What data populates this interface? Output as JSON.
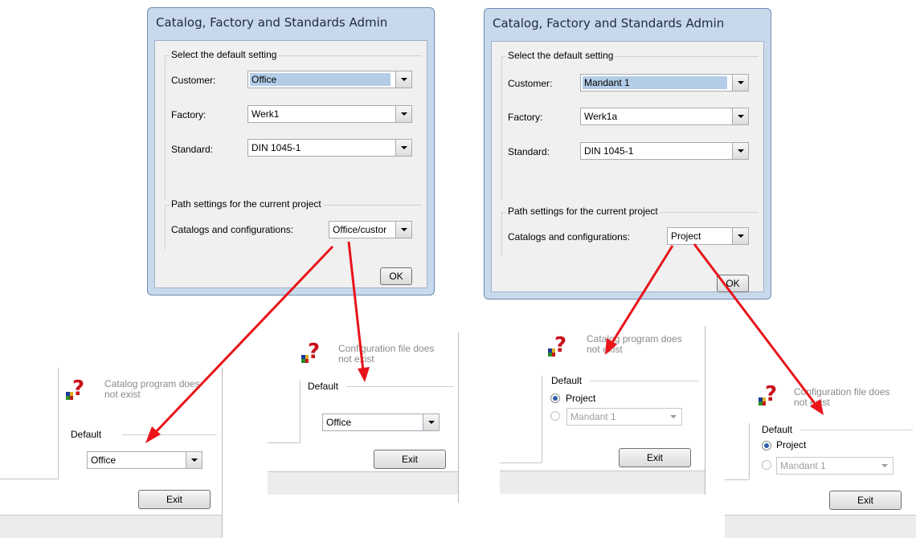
{
  "dialog_left": {
    "title": "Catalog, Factory and Standards Admin",
    "group_default": "Select the default setting",
    "customer_label": "Customer:",
    "customer_value": "Office",
    "factory_label": "Factory:",
    "factory_value": "Werk1",
    "standard_label": "Standard:",
    "standard_value": "DIN 1045-1",
    "group_path": "Path settings for the current project",
    "catalogs_label": "Catalogs and configurations:",
    "catalogs_value": "Office/custor",
    "ok_label": "OK"
  },
  "dialog_right": {
    "title": "Catalog, Factory and Standards Admin",
    "group_default": "Select the default setting",
    "customer_label": "Customer:",
    "customer_value": "Mandant 1",
    "factory_label": "Factory:",
    "factory_value": "Werk1a",
    "standard_label": "Standard:",
    "standard_value": "DIN 1045-1",
    "group_path": "Path settings for the current project",
    "catalogs_label": "Catalogs and configurations:",
    "catalogs_value": "Project",
    "ok_label": "OK"
  },
  "popup_1": {
    "message_line1": "Catalog program does",
    "message_line2": "not exist",
    "group": "Default",
    "combo_value": "Office",
    "exit_label": "Exit"
  },
  "popup_2": {
    "message_line1": "Configuration file does",
    "message_line2": "not exist",
    "group": "Default",
    "combo_value": "Office",
    "exit_label": "Exit"
  },
  "popup_3": {
    "message_line1": "Catalog program does",
    "message_line2": "not exist",
    "group": "Default",
    "radio_project": "Project",
    "combo_value": "Mandant 1",
    "exit_label": "Exit"
  },
  "popup_4": {
    "message_line1": "Configuration file does",
    "message_line2": "not exist",
    "group": "Default",
    "radio_project": "Project",
    "combo_value": "Mandant 1",
    "exit_label": "Exit"
  },
  "colors": {
    "arrow": "#e8141a",
    "title_bar": "#c9d9ec",
    "selection": "#b3cde8"
  },
  "icons": {
    "question": "question-mark-icon",
    "dropdown": "chevron-down-icon"
  }
}
